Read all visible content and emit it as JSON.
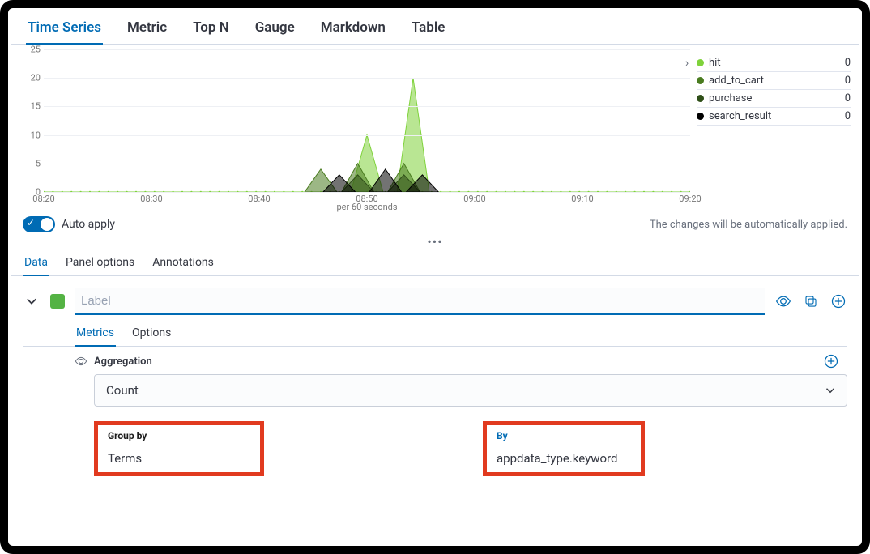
{
  "tabs": [
    "Time Series",
    "Metric",
    "Top N",
    "Gauge",
    "Markdown",
    "Table"
  ],
  "active_tab": 0,
  "chart_data": {
    "type": "area",
    "x": [
      "08:20",
      "08:30",
      "08:40",
      "08:50",
      "09:00",
      "09:10",
      "09:20"
    ],
    "ylim": [
      0,
      25
    ],
    "yticks": [
      0,
      5,
      10,
      15,
      20,
      25
    ],
    "xlabel": "per 60 seconds",
    "series": [
      {
        "name": "hit",
        "color": "#7fd23b",
        "peaks": [
          {
            "t": 50,
            "v": 10
          },
          {
            "t": 55,
            "v": 20
          }
        ]
      },
      {
        "name": "add_to_cart",
        "color": "#4a7c20",
        "peaks": [
          {
            "t": 45,
            "v": 4
          },
          {
            "t": 49,
            "v": 5
          },
          {
            "t": 54,
            "v": 5
          }
        ]
      },
      {
        "name": "purchase",
        "color": "#2f4f18",
        "peaks": [
          {
            "t": 49,
            "v": 3
          },
          {
            "t": 54,
            "v": 3
          }
        ]
      },
      {
        "name": "search_result",
        "color": "#000000",
        "peaks": [
          {
            "t": 47,
            "v": 3
          },
          {
            "t": 52,
            "v": 4
          },
          {
            "t": 56,
            "v": 3
          }
        ]
      }
    ],
    "t_min": 15,
    "t_max": 85
  },
  "legend": [
    {
      "name": "hit",
      "value": "0",
      "color": "#7fd23b"
    },
    {
      "name": "add_to_cart",
      "value": "0",
      "color": "#4a7c20"
    },
    {
      "name": "purchase",
      "value": "0",
      "color": "#2f4f18"
    },
    {
      "name": "search_result",
      "value": "0",
      "color": "#000000"
    }
  ],
  "auto_apply": {
    "label": "Auto apply",
    "hint": "The changes will be automatically applied."
  },
  "subtabs": [
    "Data",
    "Panel options",
    "Annotations"
  ],
  "active_subtab": 0,
  "metric_header": {
    "label_placeholder": "Label",
    "swatch": "#54b344"
  },
  "inner_tabs": [
    "Metrics",
    "Options"
  ],
  "active_inner_tab": 0,
  "aggregation": {
    "title": "Aggregation",
    "value": "Count"
  },
  "group_by": {
    "title": "Group by",
    "value": "Terms"
  },
  "by": {
    "title": "By",
    "value": "appdata_type.keyword"
  },
  "ellipsis": "•••"
}
